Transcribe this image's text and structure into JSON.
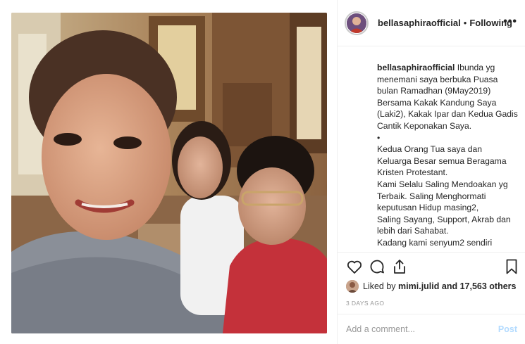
{
  "header": {
    "username": "bellasaphiraofficial",
    "separator": "•",
    "follow_state": "Following",
    "more_icon": "more-horizontal-icon"
  },
  "caption": {
    "username": "bellasaphiraofficial",
    "lines": [
      "Ibunda yg menemani saya berbuka Puasa bulan Ramadhan (9May2019)",
      "Bersama Kakak Kandung Saya (Laki2), Kakak Ipar dan Kedua Gadis Cantik Keponakan Saya.",
      "•",
      "Kedua Orang Tua saya dan Keluarga Besar semua Beragama Kristen Protestant.",
      "Kami Selalu Saling Mendoakan yg Terbaik. Saling Menghormati keputusan Hidup masing2,",
      "Saling Sayang, Support, Akrab dan lebih dari Sahabat.",
      "Kadang kami senyum2 sendiri"
    ]
  },
  "actions": {
    "like_icon": "heart-icon",
    "comment_icon": "comment-icon",
    "share_icon": "share-icon",
    "save_icon": "bookmark-icon"
  },
  "likes": {
    "prefix": "Liked by",
    "user": "mimi.julid",
    "suffix": "and 17,563 others"
  },
  "timestamp": "3 DAYS AGO",
  "comment": {
    "placeholder": "Add a comment...",
    "post_label": "Post"
  },
  "carousel": {
    "next_icon": "chevron-right-icon",
    "glyph": "›"
  },
  "colors": {
    "link_disabled": "#b3dbff",
    "border": "#efefef",
    "muted": "#999999"
  }
}
